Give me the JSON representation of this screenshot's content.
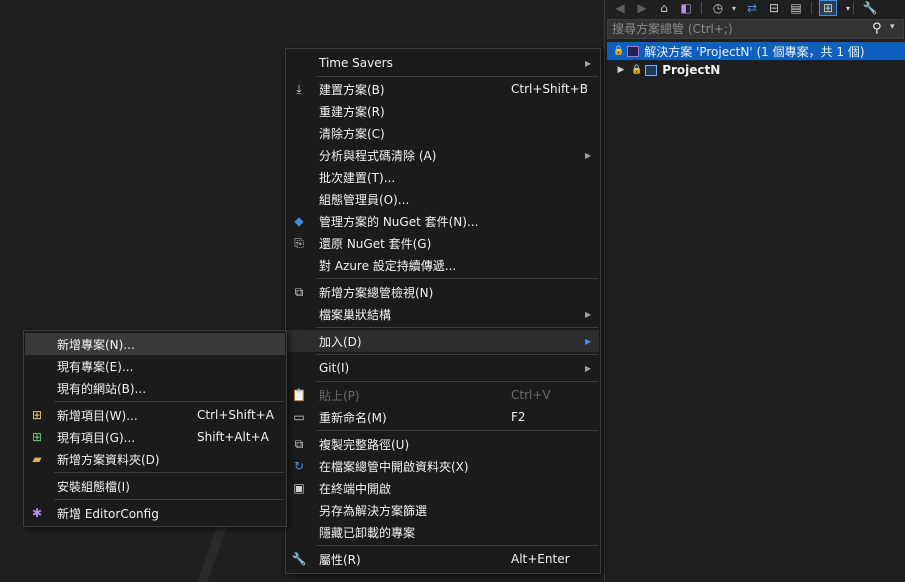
{
  "solution_explorer": {
    "search_placeholder": "搜尋方案總管 (Ctrl+;)",
    "solution_label": "解決方案 'ProjectN' (1 個專案，共 1 個)",
    "project_label": "ProjectN",
    "toolbar_icons": [
      "back-icon",
      "forward-icon",
      "home-icon",
      "vs-icon",
      "history-icon",
      "sync-icon",
      "collapse-icon",
      "show-all-files-icon",
      "switch-views-icon",
      "properties-icon"
    ]
  },
  "main_menu": {
    "time_savers": "Time Savers",
    "build_solution": "建置方案(B)",
    "build_solution_shortcut": "Ctrl+Shift+B",
    "rebuild_solution": "重建方案(R)",
    "clean_solution": "清除方案(C)",
    "analyze_cleanup": "分析與程式碼清除 (A)",
    "batch_build": "批次建置(T)...",
    "configuration_manager": "組態管理員(O)...",
    "manage_nuget": "管理方案的 NuGet 套件(N)...",
    "restore_nuget": "還原 NuGet 套件(G)",
    "azure_cd": "對 Azure 設定持續傳遞...",
    "new_view": "新增方案總管檢視(N)",
    "file_nesting": "檔案巢狀結構",
    "add": "加入(D)",
    "git": "Git(I)",
    "paste": "貼上(P)",
    "paste_shortcut": "Ctrl+V",
    "rename": "重新命名(M)",
    "rename_shortcut": "F2",
    "copy_path": "複製完整路徑(U)",
    "open_folder": "在檔案總管中開啟資料夾(X)",
    "open_terminal": "在終端中開啟",
    "save_filter": "另存為解決方案篩選",
    "hide_unloaded": "隱藏已卸載的專案",
    "properties": "屬性(R)",
    "properties_shortcut": "Alt+Enter"
  },
  "add_submenu": {
    "new_project": "新增專案(N)...",
    "existing_project": "現有專案(E)...",
    "existing_website": "現有的網站(B)...",
    "new_item": "新增項目(W)...",
    "new_item_shortcut": "Ctrl+Shift+A",
    "existing_item": "現有項目(G)...",
    "existing_item_shortcut": "Shift+Alt+A",
    "new_solution_folder": "新增方案資料夾(D)",
    "install_component": "安裝組態檔(I)",
    "new_editorconfig": "新增 EditorConfig"
  },
  "colors": {
    "accent": "#0e60bf",
    "menu_bg": "#1b1b1b",
    "background": "#1f1f1f",
    "arrow_highlight": "#3b8eea"
  }
}
